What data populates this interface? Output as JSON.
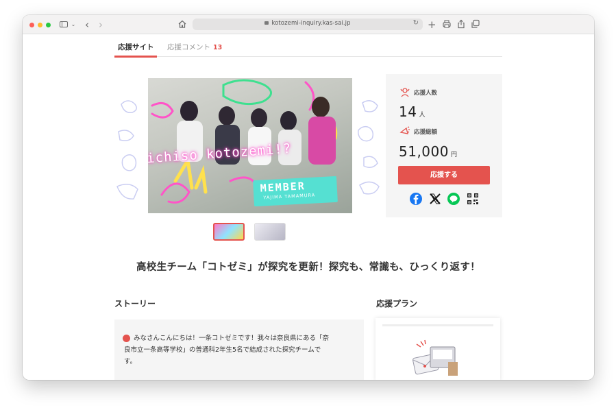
{
  "browser": {
    "url": "kotozemi-inquiry.kas-sai.jp"
  },
  "tabs": {
    "active_label": "応援サイト",
    "comments_label": "応援コメント",
    "comments_count": "13"
  },
  "hero": {
    "neon_text": "ichiso kotozemi!?",
    "member_title": "MEMBER",
    "member_sub": "YAJIMA TAMAMURA"
  },
  "stats": {
    "supporters_label": "応援人数",
    "supporters_value": "14",
    "supporters_unit": "人",
    "total_label": "応援総額",
    "total_value": "51,000",
    "total_unit": "円",
    "support_button": "応援する"
  },
  "share_icons": [
    "facebook-icon",
    "x-icon",
    "line-icon",
    "qr-code-icon"
  ],
  "headline": "高校生チーム「コトゼミ」が探究を更新！探究も、常識も、ひっくり返す！",
  "story": {
    "title": "ストーリー",
    "line1": "みなさんこんにちは！一条コトゼミです！我々は奈良県にある「奈",
    "line2": "良市立一条高等学校」の普通科2年生5名で結成された探究チームで",
    "line3": "す。"
  },
  "plans": {
    "title": "応援プラン"
  },
  "colors": {
    "accent": "#e4534e",
    "card_bg": "#f5f5f5"
  }
}
